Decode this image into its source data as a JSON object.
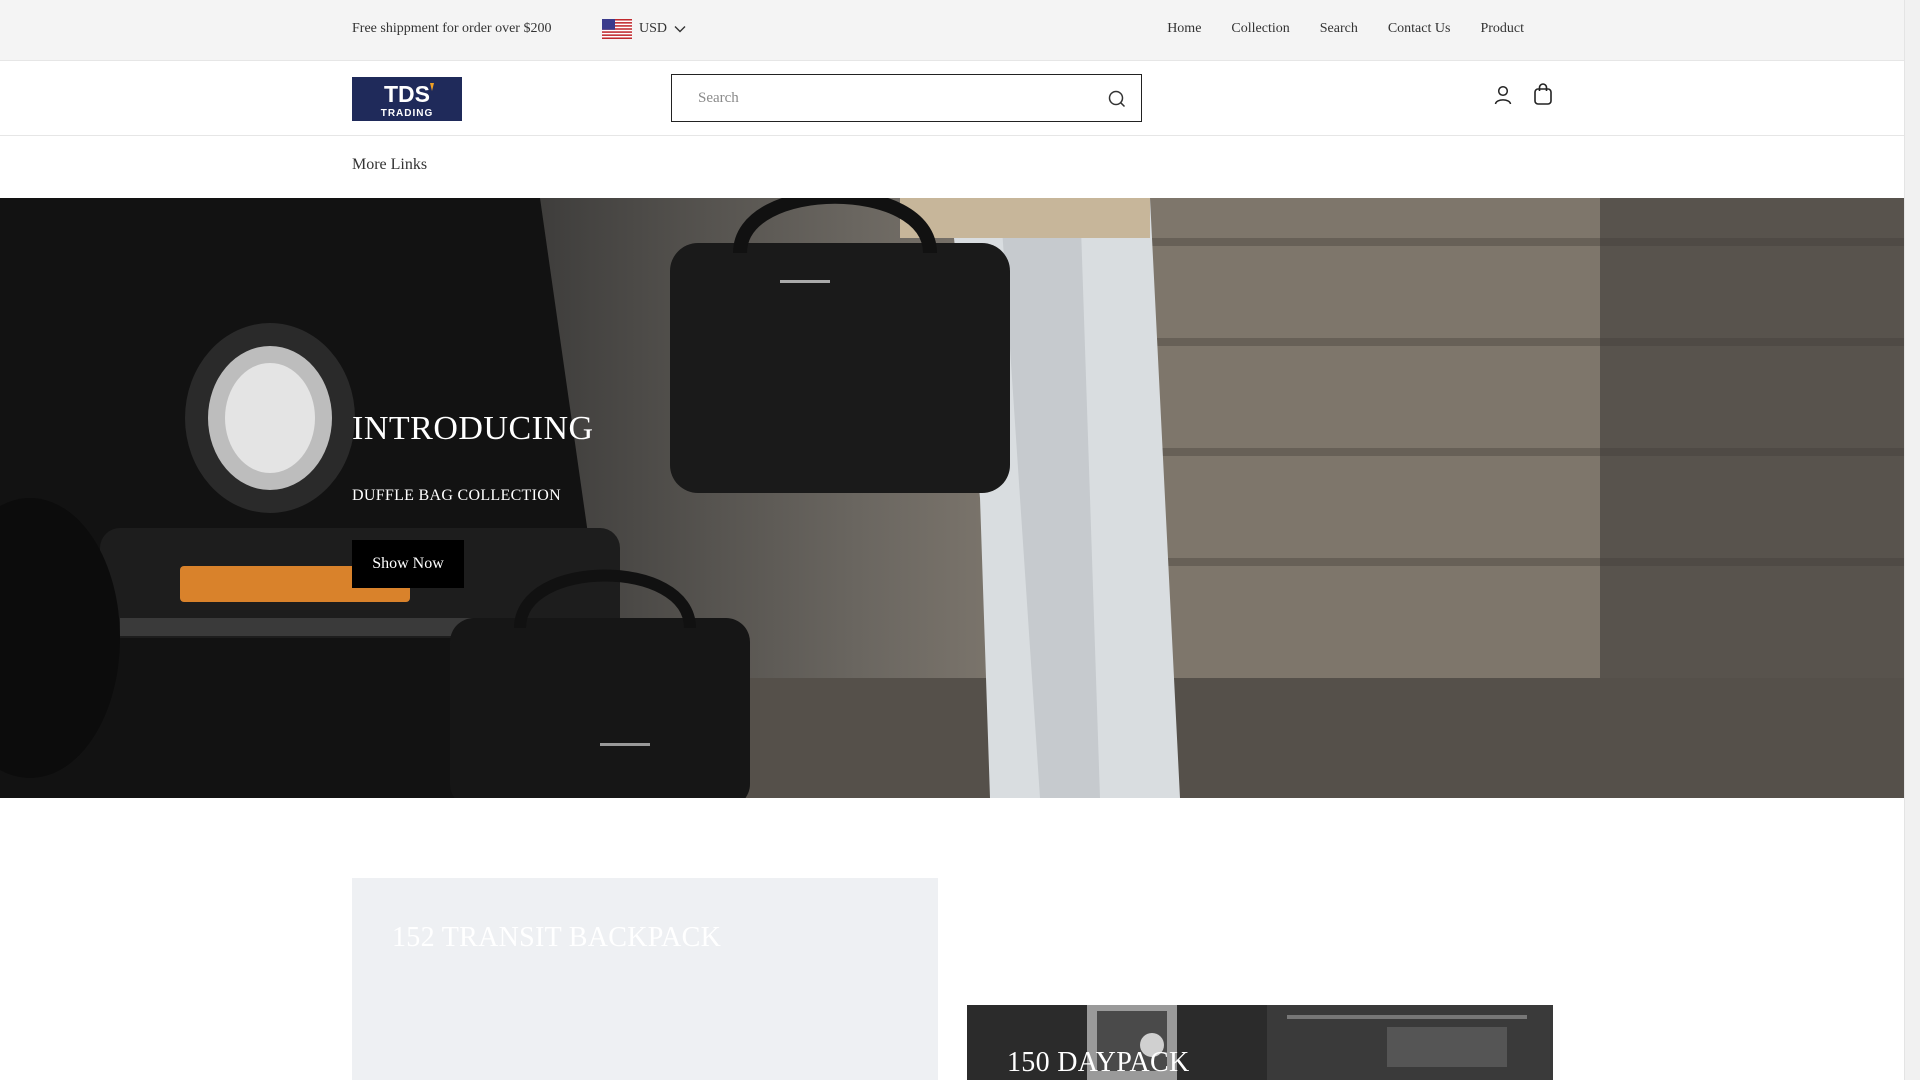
{
  "announcement": {
    "text": "Free shippment for order over $200"
  },
  "currency": {
    "code": "USD",
    "flag_icon": "us-flag-icon"
  },
  "top_nav": {
    "items": [
      {
        "label": "Home"
      },
      {
        "label": "Collection"
      },
      {
        "label": "Search"
      },
      {
        "label": "Contact Us"
      },
      {
        "label": "Product"
      }
    ]
  },
  "header": {
    "logo": {
      "line1": "TDS",
      "line2": "TRADING",
      "bg": "#1f2a5a",
      "accent": "#f0a024"
    },
    "search": {
      "placeholder": "Search",
      "value": ""
    }
  },
  "subnav": {
    "more_links": "More Links"
  },
  "hero": {
    "title": "INTRODUCING",
    "subtitle": "DUFFLE BAG COLLECTION",
    "button_label": "Show Now"
  },
  "featured": [
    {
      "title": "152 TRANSIT BACKPACK"
    },
    {
      "title": "150 DAYPACK"
    }
  ],
  "colors": {
    "button_bg": "#000000",
    "topbar_bg": "#f4f4f4",
    "card_bg": "#eef0f3"
  }
}
